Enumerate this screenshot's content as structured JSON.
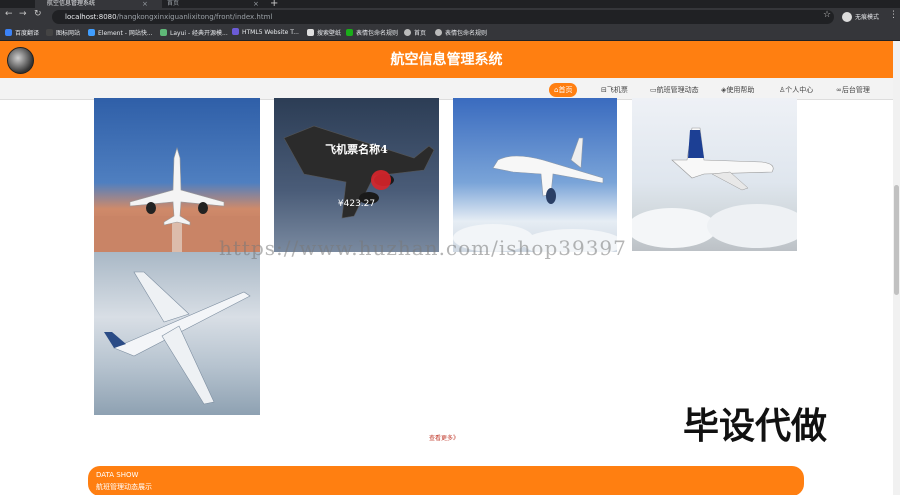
{
  "browser": {
    "tabs": [
      {
        "title": "航空信息管理系统"
      },
      {
        "title": "首页"
      }
    ],
    "url_host": "localhost:8080",
    "url_path": "/hangkongxinxiguanlixitong/front/index.html",
    "profile_label": "无痕模式",
    "bookmarks": [
      "百度翻译",
      "图标网站",
      "Element - 网站快...",
      "Layui - 经典开源模...",
      "HTML5 Website T...",
      "搜索壁纸",
      "表情包命名规则",
      "首页",
      "表情包命名规则"
    ]
  },
  "header": {
    "title": "航空信息管理系统"
  },
  "nav": {
    "items": [
      "首页",
      "飞机票",
      "航班管理动态",
      "使用帮助",
      "个人中心",
      "后台管理"
    ]
  },
  "products": {
    "overlay_title": "飞机票名称4",
    "overlay_price": "¥423.27"
  },
  "more_label": "查看更多》",
  "section": {
    "en": "DATA SHOW",
    "cn": "航班管理动态展示"
  },
  "watermark": "https://www.huzhan.com/ishop39397",
  "watermark_cn": "毕设代做",
  "colors": {
    "brand": "#ff7f11"
  }
}
